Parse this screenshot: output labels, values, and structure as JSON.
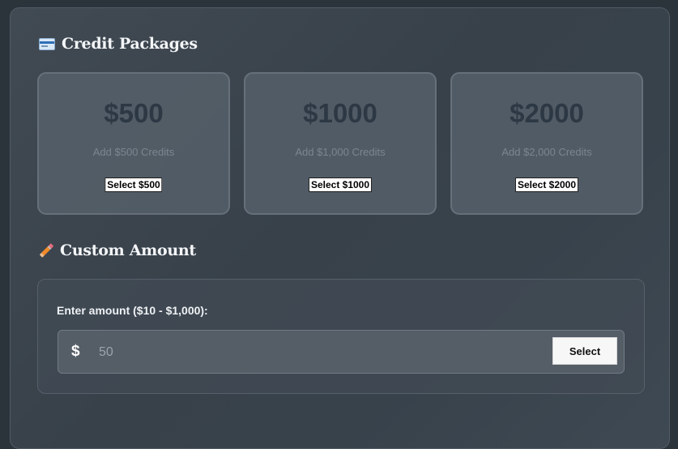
{
  "packages_section": {
    "title": "Credit Packages",
    "icon": "credit-card-icon",
    "items": [
      {
        "amount": "$500",
        "description": "Add $500 Credits",
        "button_label": "Select $500"
      },
      {
        "amount": "$1000",
        "description": "Add $1,000 Credits",
        "button_label": "Select $1000"
      },
      {
        "amount": "$2000",
        "description": "Add $2,000 Credits",
        "button_label": "Select $2000"
      }
    ]
  },
  "custom_section": {
    "title": "Custom Amount",
    "icon": "pencil-icon",
    "label": "Enter amount ($10 - $1,000):",
    "currency_symbol": "$",
    "input_placeholder": "50",
    "input_value": "",
    "button_label": "Select"
  },
  "colors": {
    "page_bg": "#2b333b",
    "card_bg": "#545e68",
    "amount_text": "#2d3845"
  }
}
